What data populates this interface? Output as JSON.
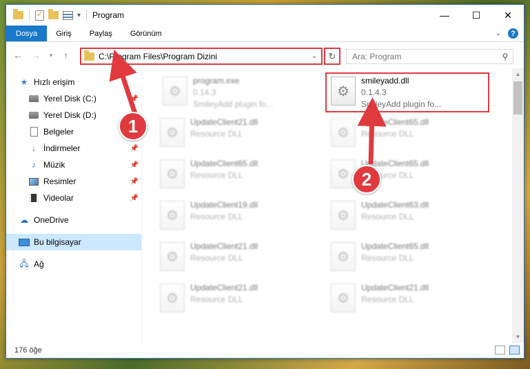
{
  "window": {
    "title": "Program",
    "controls": [
      "minimize",
      "maximize",
      "close"
    ]
  },
  "ribbon": {
    "tabs": [
      "Dosya",
      "Giriş",
      "Paylaş",
      "Görünüm"
    ],
    "active_tab": "Dosya"
  },
  "address": {
    "path": "C:\\Program Files\\Program Dizini",
    "search_placeholder": "Ara: Program"
  },
  "nav": {
    "quick_access": "Hızlı erişim",
    "items": [
      {
        "label": "Yerel Disk (C:)",
        "icon": "disk-icon",
        "pinned": true
      },
      {
        "label": "Yerel Disk (D:)",
        "icon": "disk-icon",
        "pinned": true
      },
      {
        "label": "Belgeler",
        "icon": "documents-icon",
        "pinned": true
      },
      {
        "label": "İndirmeler",
        "icon": "download-icon",
        "pinned": true
      },
      {
        "label": "Müzik",
        "icon": "music-icon",
        "pinned": true
      },
      {
        "label": "Resimler",
        "icon": "pictures-icon",
        "pinned": true
      },
      {
        "label": "Videolar",
        "icon": "videos-icon",
        "pinned": true
      }
    ],
    "onedrive": "OneDrive",
    "this_pc": "Bu bilgisayar",
    "network": "Ağ"
  },
  "files": [
    {
      "name": "program.exe",
      "line2": "0.14.3",
      "line3": "SmileyAdd plugin fo...",
      "blurred": true
    },
    {
      "name": "smileyadd.dll",
      "line2": "0.1.4.3",
      "line3": "SmileyAdd plugin fo...",
      "blurred": false
    },
    {
      "name": "UpdateClient21.dll",
      "line2": "Resource DLL",
      "blurred": true
    },
    {
      "name": "UpdateClient65.dll",
      "line2": "Resource DLL",
      "blurred": true
    },
    {
      "name": "UpdateClient65.dll",
      "line2": "Resource DLL",
      "blurred": true
    },
    {
      "name": "UpdateClient65.dll",
      "line2": "Resource DLL",
      "blurred": true
    },
    {
      "name": "UpdateClient19.dll",
      "line2": "Resource DLL",
      "blurred": true
    },
    {
      "name": "UpdateClient63.dll",
      "line2": "Resource DLL",
      "blurred": true
    },
    {
      "name": "UpdateClient21.dll",
      "line2": "Resource DLL",
      "blurred": true
    },
    {
      "name": "UpdateClient65.dll",
      "line2": "Resource DLL",
      "blurred": true
    },
    {
      "name": "UpdateClient21.dll",
      "line2": "Resource DLL",
      "blurred": true
    },
    {
      "name": "UpdateClient21.dll",
      "line2": "Resource DLL",
      "blurred": true
    }
  ],
  "status": {
    "item_count": "176 öğe"
  },
  "callouts": [
    "1",
    "2"
  ],
  "colors": {
    "accent": "#1979ca",
    "callout": "#e0393e",
    "selection": "#cce8ff"
  }
}
